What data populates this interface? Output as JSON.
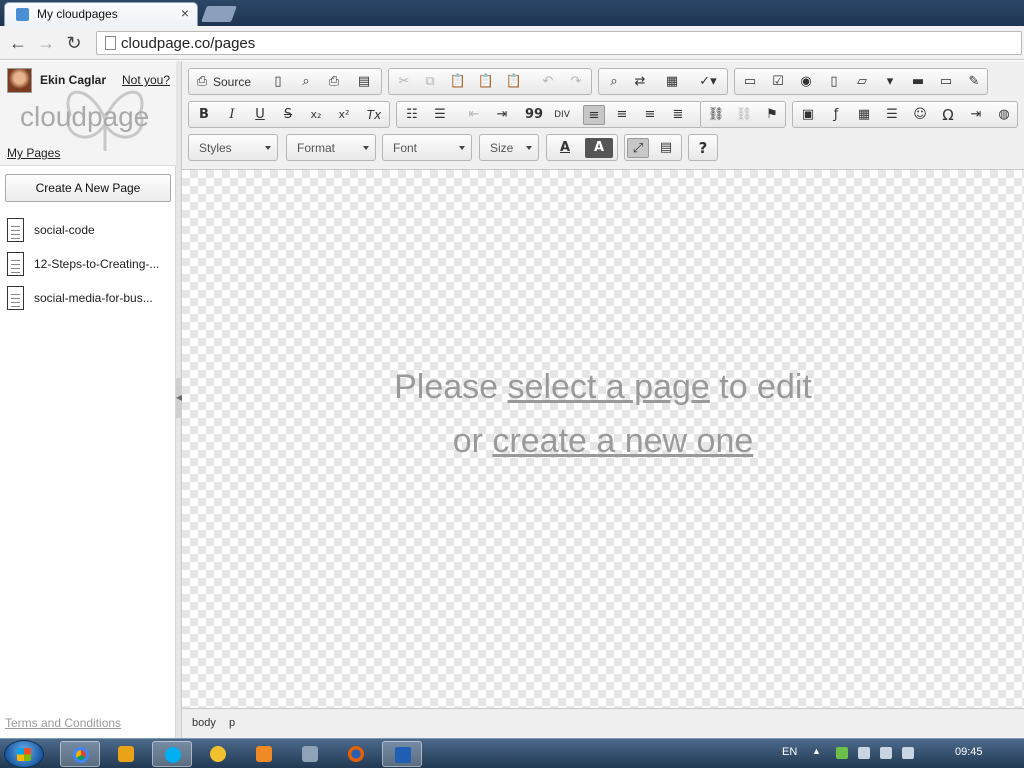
{
  "browser": {
    "tab_title": "My cloudpages",
    "tab_close": "×",
    "url": "cloudpage.co/pages",
    "back": "←",
    "forward": "→",
    "reload": "↻"
  },
  "sidebar": {
    "user_name": "Ekin Caglar",
    "not_you": "Not you?",
    "logo_text": "cloudpage",
    "my_pages": "My Pages",
    "create_button": "Create A New Page",
    "pages": [
      {
        "label": "social-code"
      },
      {
        "label": "12-Steps-to-Creating-..."
      },
      {
        "label": "social-media-for-bus..."
      }
    ],
    "terms": "Terms and Conditions"
  },
  "editor": {
    "toolbar": {
      "source_label": "Source",
      "styles": "Styles",
      "format": "Format",
      "font": "Font",
      "size": "Size",
      "bold": "B",
      "italic": "I",
      "underline": "U",
      "strike": "S",
      "subscript": "x₂",
      "superscript": "x²",
      "remove_format": "Tx",
      "blockquote": "99",
      "text_color": "A",
      "bg_color": "A",
      "help": "?",
      "omega": "Ω"
    },
    "message": {
      "line1_pre": "Please ",
      "line1_link": "select a page",
      "line1_post": " to edit",
      "line2_pre": "or ",
      "line2_link": "create a new one"
    },
    "status_path": [
      "body",
      "p"
    ]
  },
  "taskbar": {
    "language": "EN",
    "clock": "09:45"
  },
  "colors": {
    "taskbar": "#2f4c6c",
    "tab_strip": "#25405f",
    "message_text": "#9a9a9a"
  }
}
